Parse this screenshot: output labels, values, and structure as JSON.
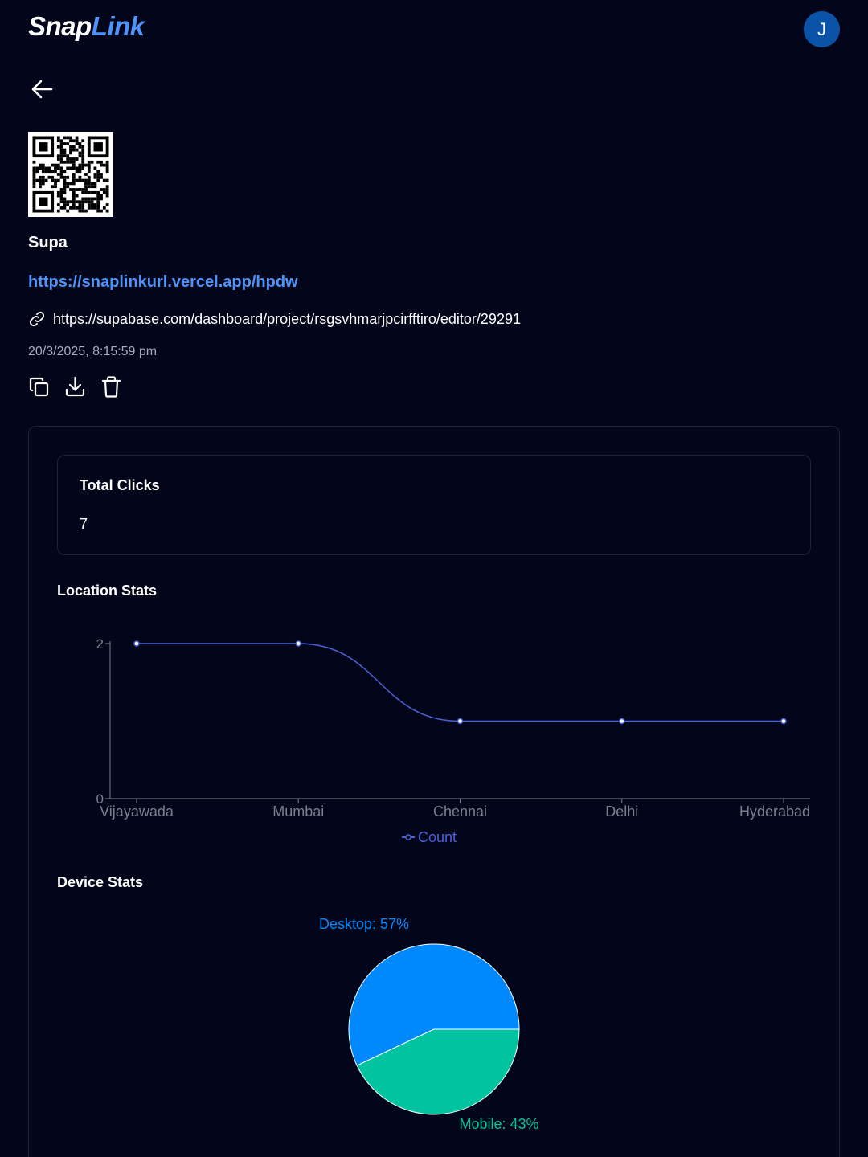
{
  "header": {
    "logo_part1": "Snap",
    "logo_part2": "Link",
    "avatar_initial": "J"
  },
  "link": {
    "title": "Supa",
    "short_url": "https://snaplinkurl.vercel.app/hpdw",
    "original_url": "https://supabase.com/dashboard/project/rsgsvhmarjpcirfftiro/editor/29291",
    "created_at": "20/3/2025, 8:15:59 pm"
  },
  "icons": {
    "back": "arrow-left-icon",
    "link": "link-icon",
    "copy": "copy-icon",
    "download": "download-icon",
    "delete": "trash-icon"
  },
  "stats": {
    "total_clicks_label": "Total Clicks",
    "total_clicks_value": "7",
    "location_title": "Location Stats",
    "device_title": "Device Stats"
  },
  "colors": {
    "accent": "#4f93f7",
    "line": "#4b63d9",
    "desktop": "#0088fe",
    "mobile": "#00c49f"
  },
  "chart_data": [
    {
      "type": "line",
      "categories": [
        "Vijayawada",
        "Mumbai",
        "Chennai",
        "Delhi",
        "Hyderabad"
      ],
      "series": [
        {
          "name": "Count",
          "values": [
            2,
            2,
            1,
            1,
            1
          ]
        }
      ],
      "yticks": [
        "0",
        "2"
      ],
      "ylim": [
        0,
        2
      ],
      "legend": "bottom-center"
    },
    {
      "type": "pie",
      "slices": [
        {
          "name": "Desktop",
          "value": 57,
          "label": "Desktop: 57%"
        },
        {
          "name": "Mobile",
          "value": 43,
          "label": "Mobile: 43%"
        }
      ]
    }
  ]
}
